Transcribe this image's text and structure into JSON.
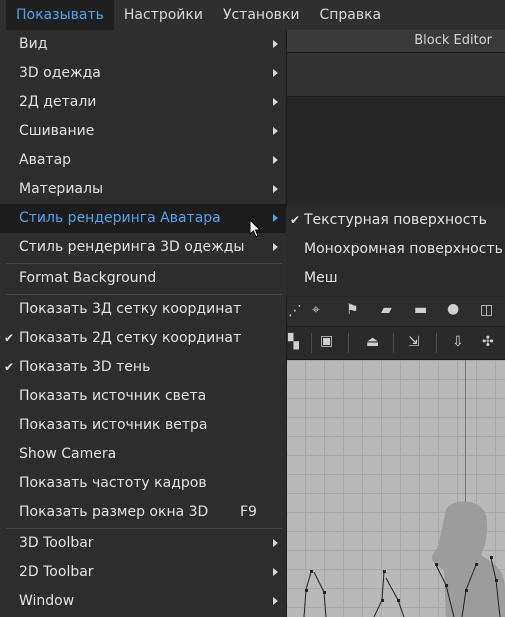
{
  "menubar": {
    "items": [
      "Показывать",
      "Настройки",
      "Установки",
      "Справка"
    ]
  },
  "block_editor": {
    "title": "Block Editor"
  },
  "dropdown": {
    "items": [
      {
        "label": "Вид"
      },
      {
        "label": "3D одежда"
      },
      {
        "label": "2Д детали"
      },
      {
        "label": "Сшивание"
      },
      {
        "label": "Аватар"
      },
      {
        "label": "Материалы"
      },
      {
        "label": "Стиль рендеринга Аватара"
      },
      {
        "label": "Стиль рендеринга 3D одежды"
      },
      {
        "label": "Format Background"
      },
      {
        "label": "Показать 3Д сетку координат"
      },
      {
        "label": "Показать 2Д сетку координат",
        "checked": true
      },
      {
        "label": "Показать 3D тень",
        "checked": true
      },
      {
        "label": "Показать источник света"
      },
      {
        "label": "Показать источник ветра"
      },
      {
        "label": "Show Camera"
      },
      {
        "label": "Показать частоту кадров"
      },
      {
        "label": "Показать размер окна 3D",
        "shortcut": "F9"
      },
      {
        "label": "3D Toolbar"
      },
      {
        "label": "2D Toolbar"
      },
      {
        "label": "Window"
      }
    ]
  },
  "submenu": {
    "items": [
      {
        "label": "Текстурная поверхность",
        "checked": true
      },
      {
        "label": "Монохромная поверхность"
      },
      {
        "label": "Меш"
      }
    ]
  },
  "check_glyph": "✔",
  "colors": {
    "accent": "#4aa3f0",
    "menu_bg": "#2d2d2d",
    "highlight_bg": "#1c1c1c"
  }
}
